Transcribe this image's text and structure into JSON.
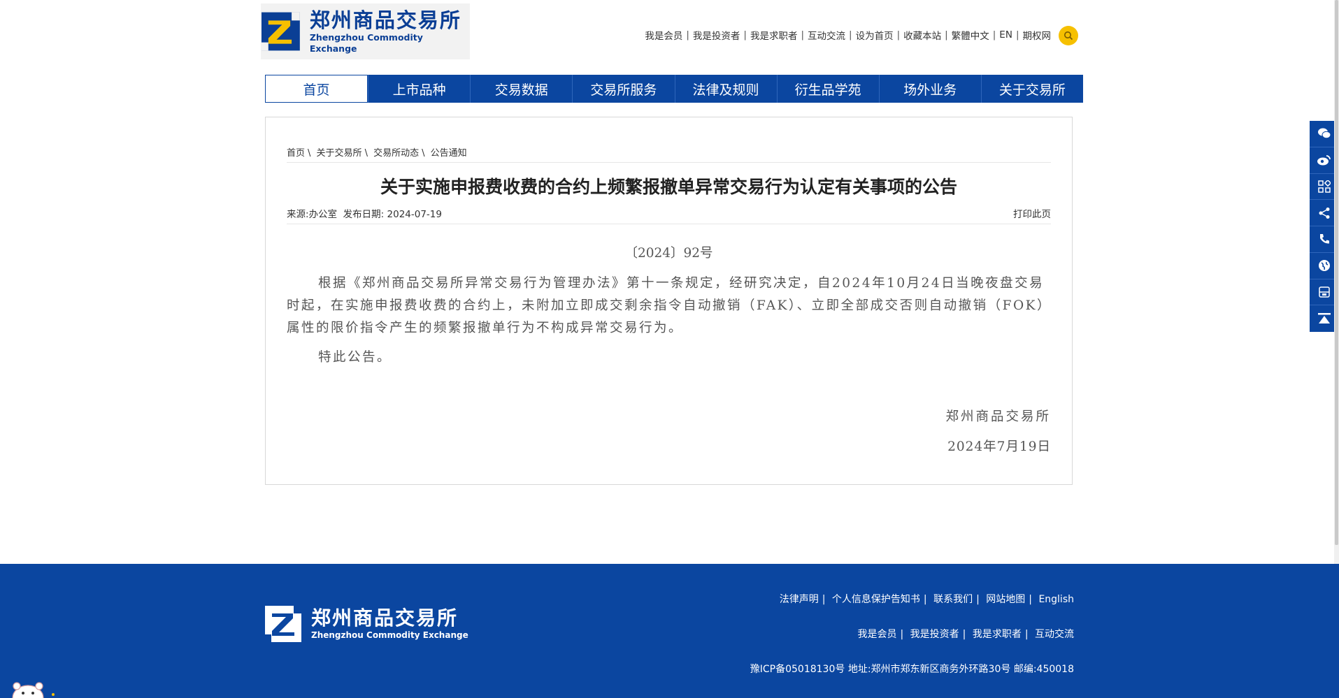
{
  "logo": {
    "cn": "郑州商品交易所",
    "en": "Zhengzhou Commodity Exchange"
  },
  "toplinks": [
    "我是会员",
    "我是投资者",
    "我是求职者",
    "互动交流",
    "设为首页",
    "收藏本站",
    "繁體中文",
    "EN",
    "期权网"
  ],
  "nav": [
    "首页",
    "上市品种",
    "交易数据",
    "交易所服务",
    "法律及规则",
    "衍生品学苑",
    "场外业务",
    "关于交易所"
  ],
  "breadcrumb": [
    "首页",
    "关于交易所",
    "交易所动态",
    "公告通知"
  ],
  "article": {
    "title": "关于实施申报费收费的合约上频繁报撤单异常交易行为认定有关事项的公告",
    "source_label": "来源:",
    "source": "办公室",
    "date_label": "发布日期:",
    "date": "2024-07-19",
    "print": "打印此页",
    "doc_no": "〔2024〕92号",
    "paragraph1": "根据《郑州商品交易所异常交易行为管理办法》第十一条规定，经研究决定，自2024年10月24日当晚夜盘交易时起，在实施申报费收费的合约上，未附加立即成交剩余指令自动撤销（FAK）、立即全部成交否则自动撤销（FOK）属性的限价指令产生的频繁报撤单行为不构成异常交易行为。",
    "paragraph2": "特此公告。",
    "signature": "郑州商品交易所",
    "sign_date": "2024年7月19日"
  },
  "sidebar_icons": [
    "wechat-icon",
    "weibo-icon",
    "qrcode-icon",
    "share-icon",
    "phone-icon",
    "globe-icon",
    "app-icon",
    "back-to-top-icon"
  ],
  "footer": {
    "logo_cn": "郑州商品交易所",
    "logo_en": "Zhengzhou Commodity Exchange",
    "links1": [
      "法律声明",
      "个人信息保护告知书",
      "联系我们",
      "网站地图",
      "English"
    ],
    "links2": [
      "我是会员",
      "我是投资者",
      "我是求职者",
      "互动交流"
    ],
    "icp": "豫ICP备05018130号",
    "address_label": "地址:",
    "address": "郑州市郑东新区商务外环路30号",
    "postcode_label": "邮编:",
    "postcode": "450018"
  },
  "colors": {
    "brand_blue": "#0b46a0",
    "search_yellow": "#f6c000",
    "logo_blue": "#0b3f95"
  }
}
